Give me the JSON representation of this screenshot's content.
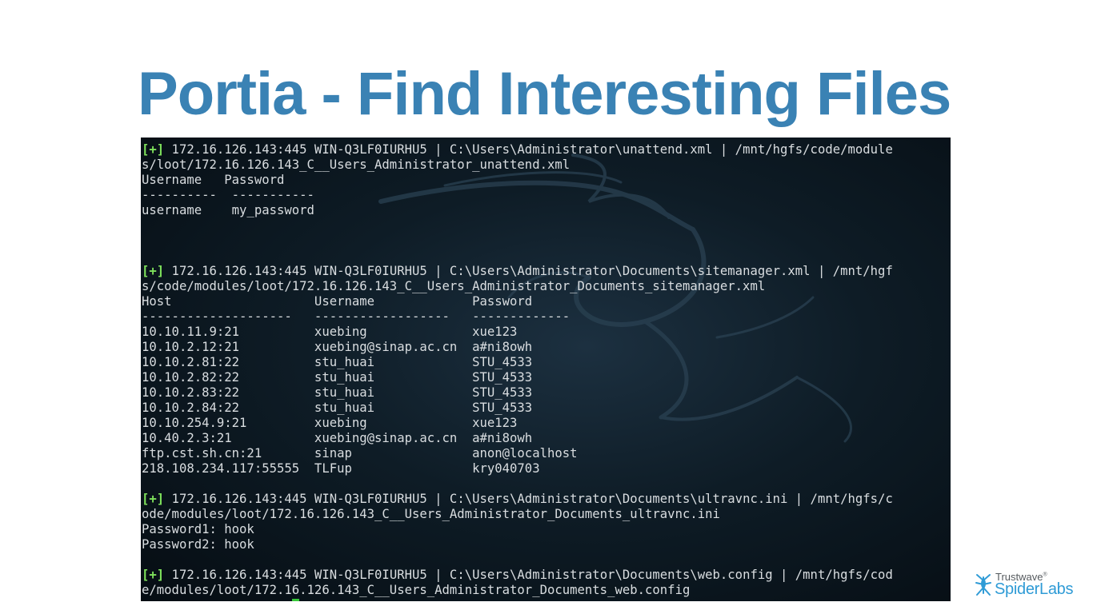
{
  "slide": {
    "title": "Portia - Find Interesting Files"
  },
  "terminal": {
    "tag": "[+]",
    "block1": {
      "line1": " 172.16.126.143:445 WIN-Q3LF0IURHU5 | C:\\Users\\Administrator\\unattend.xml | /mnt/hgfs/code/module",
      "line2": "s/loot/172.16.126.143_C__Users_Administrator_unattend.xml",
      "header": "Username   Password",
      "rule": "----------  -----------",
      "row": "username    my_password"
    },
    "block2": {
      "line1": " 172.16.126.143:445 WIN-Q3LF0IURHU5 | C:\\Users\\Administrator\\Documents\\sitemanager.xml | /mnt/hgf",
      "line2": "s/code/modules/loot/172.16.126.143_C__Users_Administrator_Documents_sitemanager.xml",
      "header": "Host                   Username             Password",
      "rule": "--------------------   ------------------   -------------",
      "rows": [
        "10.10.11.9:21          xuebing              xue123",
        "10.10.2.12:21          xuebing@sinap.ac.cn  a#ni8owh",
        "10.10.2.81:22          stu_huai             STU_4533",
        "10.10.2.82:22          stu_huai             STU_4533",
        "10.10.2.83:22          stu_huai             STU_4533",
        "10.10.2.84:22          stu_huai             STU_4533",
        "10.10.254.9:21         xuebing              xue123",
        "10.40.2.3:21           xuebing@sinap.ac.cn  a#ni8owh",
        "ftp.cst.sh.cn:21       sinap                anon@localhost",
        "218.108.234.117:55555  TLFup                kry040703"
      ]
    },
    "block3": {
      "line1": " 172.16.126.143:445 WIN-Q3LF0IURHU5 | C:\\Users\\Administrator\\Documents\\ultravnc.ini | /mnt/hgfs/c",
      "line2": "ode/modules/loot/172.16.126.143_C__Users_Administrator_Documents_ultravnc.ini",
      "password1": "Password1: hook",
      "password2": "Password2: hook"
    },
    "block4": {
      "line1": " 172.16.126.143:445 WIN-Q3LF0IURHU5 | C:\\Users\\Administrator\\Documents\\web.config | /mnt/hgfs/cod",
      "line2": "e/modules/loot/172.16.126.143_C__Users_Administrator_Documents_web.config"
    }
  },
  "brand": {
    "top": "Trustwave",
    "trademark": "®",
    "bottom": "SpiderLabs",
    "icon": "spider-icon"
  },
  "colors": {
    "title": "#3a82b4",
    "prompt_tag": "#7fe25c",
    "brand_blue": "#2f9bd6",
    "terminal_bg": "#0e1c26"
  }
}
